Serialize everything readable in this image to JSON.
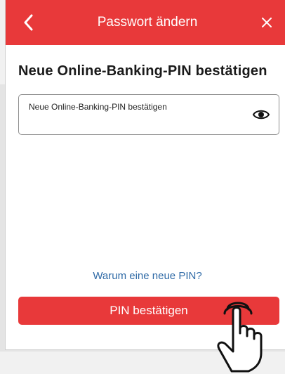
{
  "header": {
    "title": "Passwort ändern",
    "background": "#e8393a",
    "back_icon": "chevron-left-icon",
    "close_icon": "close-icon"
  },
  "main": {
    "heading": "Neue Online-Banking-PIN bestätigen",
    "pin_field": {
      "label": "Neue Online-Banking-PIN bestätigen",
      "value": "",
      "visibility_icon": "eye-icon"
    },
    "why_link": "Warum eine neue PIN?",
    "confirm_button": "PIN bestätigen",
    "link_color": "#2f6aa6"
  },
  "overlay": {
    "pointer_icon": "hand-pointer-icon"
  }
}
